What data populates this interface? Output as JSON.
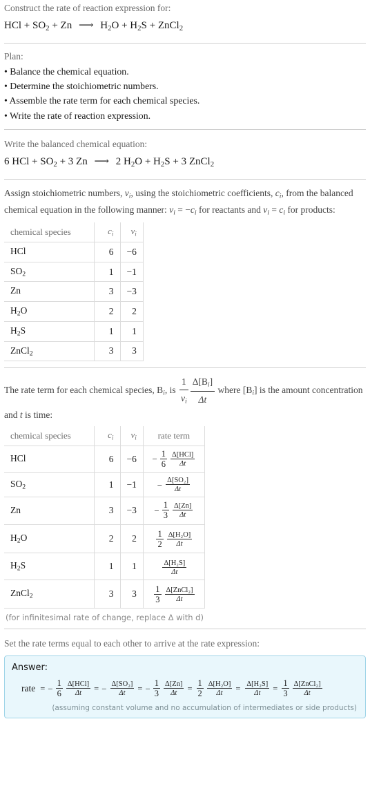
{
  "header": {
    "prompt": "Construct the rate of reaction expression for:",
    "equation": {
      "reactants": [
        {
          "formula": "HCl",
          "sub": ""
        },
        {
          "formula": "SO",
          "sub": "2"
        },
        {
          "formula": "Zn",
          "sub": ""
        }
      ],
      "products": [
        {
          "formula": "H",
          "sub": "2",
          "tail": "O"
        },
        {
          "formula": "H",
          "sub": "2",
          "tail": "S"
        },
        {
          "formula": "ZnCl",
          "sub": "2",
          "tail": ""
        }
      ],
      "arrow": "⟶",
      "plus": "+"
    }
  },
  "plan": {
    "heading": "Plan:",
    "items": [
      "• Balance the chemical equation.",
      "• Determine the stoichiometric numbers.",
      "• Assemble the rate term for each chemical species.",
      "• Write the rate of reaction expression."
    ]
  },
  "balanced": {
    "heading": "Write the balanced chemical equation:",
    "text_parts": {
      "c_hcl": "6",
      "hcl": "HCl",
      "c_so2": "",
      "so2": "SO",
      "so2_sub": "2",
      "c_zn": "3",
      "zn": "Zn",
      "c_h2o": "2",
      "h2o": "H",
      "h2o_sub": "2",
      "h2o_tail": "O",
      "c_h2s": "",
      "h2s": "H",
      "h2s_sub": "2",
      "h2s_tail": "S",
      "c_zncl2": "3",
      "zncl2": "ZnCl",
      "zncl2_sub": "2"
    }
  },
  "stoich_para": {
    "p1": "Assign stoichiometric numbers, ",
    "v1": "ν",
    "v1sub": "i",
    "p2": ", using the stoichiometric coefficients, ",
    "c1": "c",
    "c1sub": "i",
    "p3": ", from the balanced chemical equation in the following manner: ",
    "v2": "ν",
    "v2sub": "i",
    "eq1": " = −",
    "c2": "c",
    "c2sub": "i",
    "p4": " for reactants and ",
    "v3": "ν",
    "v3sub": "i",
    "eq2": " = ",
    "c3": "c",
    "c3sub": "i",
    "p5": " for products:"
  },
  "table1": {
    "headers": {
      "species": "chemical species",
      "ci": "c",
      "ci_sub": "i",
      "vi": "ν",
      "vi_sub": "i"
    },
    "rows": [
      {
        "species": "HCl",
        "sub": "",
        "tail": "",
        "ci": "6",
        "vi": "−6"
      },
      {
        "species": "SO",
        "sub": "2",
        "tail": "",
        "ci": "1",
        "vi": "−1"
      },
      {
        "species": "Zn",
        "sub": "",
        "tail": "",
        "ci": "3",
        "vi": "−3"
      },
      {
        "species": "H",
        "sub": "2",
        "tail": "O",
        "ci": "2",
        "vi": "2"
      },
      {
        "species": "H",
        "sub": "2",
        "tail": "S",
        "ci": "1",
        "vi": "1"
      },
      {
        "species": "ZnCl",
        "sub": "2",
        "tail": "",
        "ci": "3",
        "vi": "3"
      }
    ]
  },
  "rate_para": {
    "p1": "The rate term for each chemical species, ",
    "b1": "B",
    "b1sub": "i",
    "p2": ", is ",
    "frac_num": "1",
    "frac_den": "ν",
    "frac_den_sub": "i",
    "frac2_num": "Δ[B",
    "frac2_num_sub": "i",
    "frac2_num_end": "]",
    "frac2_den": "Δt",
    "p3": " where [B",
    "b2sub": "i",
    "p4": "] is the amount concentration and ",
    "t": "t",
    "p5": " is time:"
  },
  "table2": {
    "headers": {
      "species": "chemical species",
      "ci": "c",
      "ci_sub": "i",
      "vi": "ν",
      "vi_sub": "i",
      "rate": "rate term"
    },
    "rows": [
      {
        "species": "HCl",
        "sub": "",
        "tail": "",
        "ci": "6",
        "vi": "−6",
        "sign": "−",
        "coef_num": "1",
        "coef_den": "6",
        "d_num": "Δ[HCl]",
        "d_den": "Δt"
      },
      {
        "species": "SO",
        "sub": "2",
        "tail": "",
        "ci": "1",
        "vi": "−1",
        "sign": "−",
        "coef_num": "",
        "coef_den": "",
        "d_num": "Δ[SO₂]",
        "d_den": "Δt"
      },
      {
        "species": "Zn",
        "sub": "",
        "tail": "",
        "ci": "3",
        "vi": "−3",
        "sign": "−",
        "coef_num": "1",
        "coef_den": "3",
        "d_num": "Δ[Zn]",
        "d_den": "Δt"
      },
      {
        "species": "H",
        "sub": "2",
        "tail": "O",
        "ci": "2",
        "vi": "2",
        "sign": "",
        "coef_num": "1",
        "coef_den": "2",
        "d_num": "Δ[H₂O]",
        "d_den": "Δt"
      },
      {
        "species": "H",
        "sub": "2",
        "tail": "S",
        "ci": "1",
        "vi": "1",
        "sign": "",
        "coef_num": "",
        "coef_den": "",
        "d_num": "Δ[H₂S]",
        "d_den": "Δt"
      },
      {
        "species": "ZnCl",
        "sub": "2",
        "tail": "",
        "ci": "3",
        "vi": "3",
        "sign": "",
        "coef_num": "1",
        "coef_den": "3",
        "d_num": "Δ[ZnCl₂]",
        "d_den": "Δt"
      }
    ],
    "note": "(for infinitesimal rate of change, replace Δ with d)"
  },
  "final": {
    "heading": "Set the rate terms equal to each other to arrive at the rate expression:",
    "answer_label": "Answer:",
    "rate_word": "rate",
    "equals": "=",
    "terms": [
      {
        "sign": "−",
        "coef_num": "1",
        "coef_den": "6",
        "d_num": "Δ[HCl]",
        "d_den": "Δt"
      },
      {
        "sign": "−",
        "coef_num": "",
        "coef_den": "",
        "d_num": "Δ[SO₂]",
        "d_den": "Δt"
      },
      {
        "sign": "−",
        "coef_num": "1",
        "coef_den": "3",
        "d_num": "Δ[Zn]",
        "d_den": "Δt"
      },
      {
        "sign": "",
        "coef_num": "1",
        "coef_den": "2",
        "d_num": "Δ[H₂O]",
        "d_den": "Δt"
      },
      {
        "sign": "",
        "coef_num": "",
        "coef_den": "",
        "d_num": "Δ[H₂S]",
        "d_den": "Δt"
      },
      {
        "sign": "",
        "coef_num": "1",
        "coef_den": "3",
        "d_num": "Δ[ZnCl₂]",
        "d_den": "Δt"
      }
    ],
    "assumption": "(assuming constant volume and no accumulation of intermediates or side products)"
  },
  "colors": {
    "answer_bg": "#e9f7fc",
    "answer_border": "#9fd4e8",
    "divider": "#cfcfcf",
    "prompt_text": "#6a6a6a"
  }
}
